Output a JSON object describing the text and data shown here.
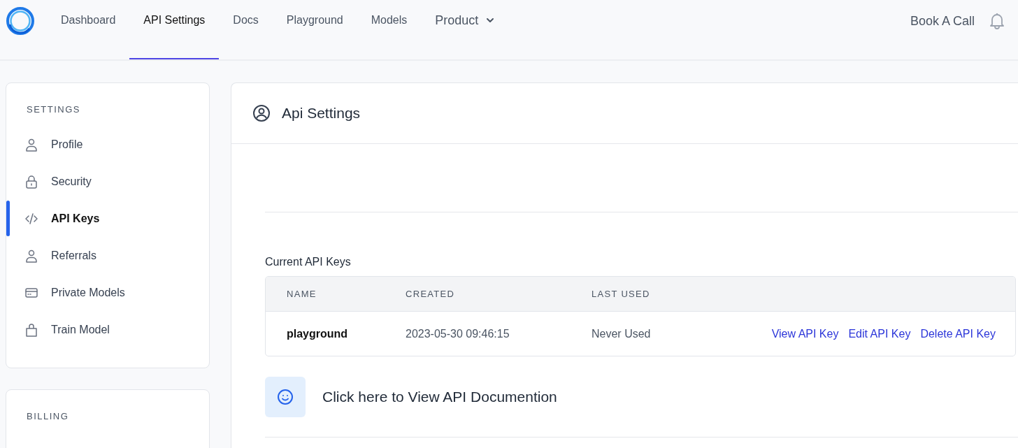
{
  "nav": {
    "items": [
      {
        "label": "Dashboard",
        "selected": false,
        "dropdown": false
      },
      {
        "label": "API Settings",
        "selected": true,
        "dropdown": false
      },
      {
        "label": "Docs",
        "selected": false,
        "dropdown": false
      },
      {
        "label": "Playground",
        "selected": false,
        "dropdown": false
      },
      {
        "label": "Models",
        "selected": false,
        "dropdown": false
      },
      {
        "label": "Product",
        "selected": false,
        "dropdown": true
      }
    ],
    "cta": "Book A Call"
  },
  "sidebar": {
    "sections": [
      {
        "title": "SETTINGS",
        "items": [
          {
            "label": "Profile",
            "selected": false
          },
          {
            "label": "Security",
            "selected": false
          },
          {
            "label": "API Keys",
            "selected": true
          },
          {
            "label": "Referrals",
            "selected": false
          },
          {
            "label": "Private Models",
            "selected": false
          },
          {
            "label": "Train Model",
            "selected": false
          }
        ]
      },
      {
        "title": "BILLING"
      }
    ]
  },
  "main": {
    "title": "Api Settings",
    "keys_title": "Current API Keys",
    "table": {
      "columns": [
        "NAME",
        "CREATED",
        "LAST USED"
      ],
      "rows": [
        {
          "name": "playground",
          "created": "2023-05-30 09:46:15",
          "last_used": "Never Used",
          "actions": [
            "View API Key",
            "Edit API Key",
            "Delete API Key"
          ]
        }
      ]
    },
    "doc_link": "Click here to View API Documention"
  }
}
